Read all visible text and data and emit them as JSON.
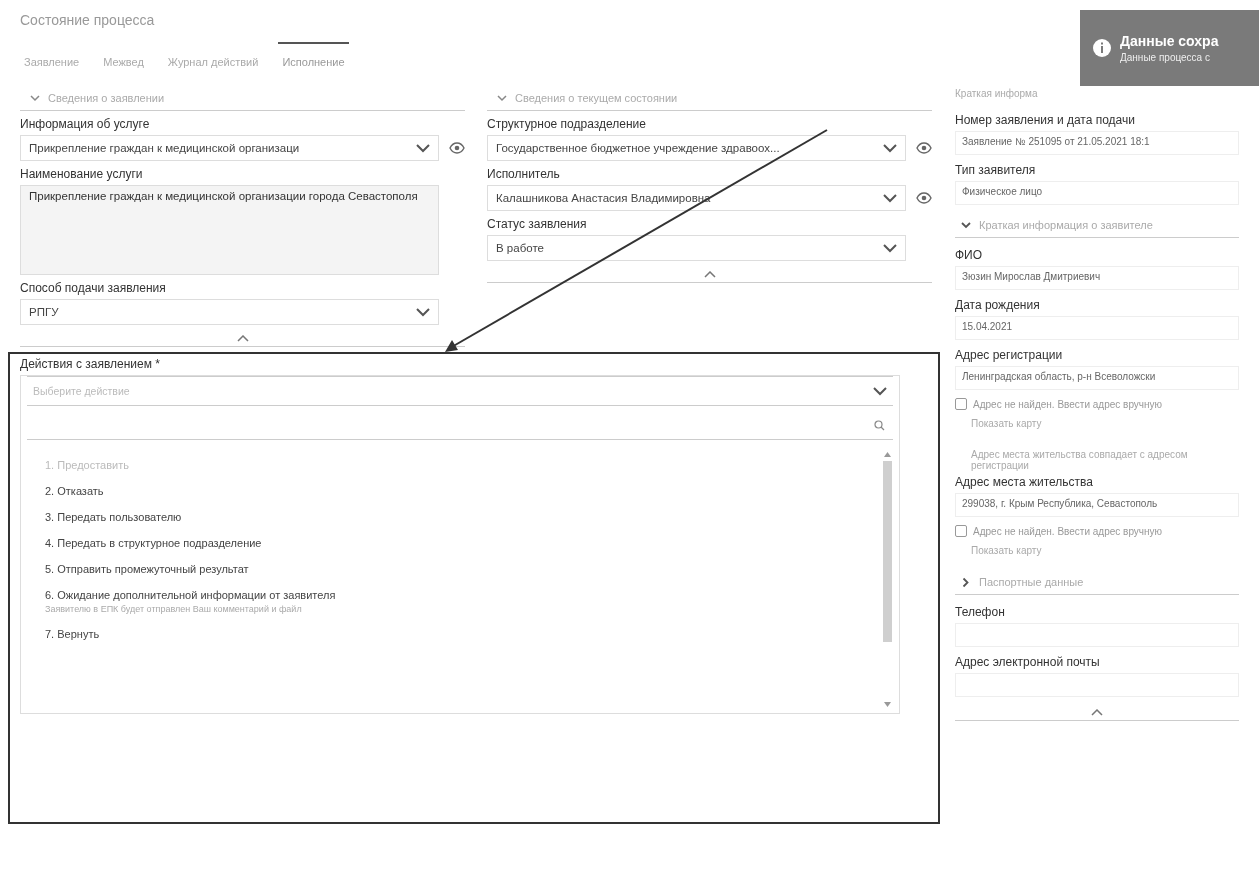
{
  "page_title": "Состояние процесса",
  "tabs": [
    {
      "label": "Заявление",
      "selected": false
    },
    {
      "label": "Межвед",
      "selected": false
    },
    {
      "label": "Журнал действий",
      "selected": false
    },
    {
      "label": "Исполнение",
      "selected": true
    }
  ],
  "application_section": {
    "title": "Сведения о заявлении",
    "expanded": true,
    "fields": [
      {
        "kind": "select",
        "label": "Информация об услуге",
        "value": "Прикрепление граждан к медицинской организаци",
        "eye": true
      },
      {
        "kind": "textarea",
        "label": "Наименование услуги",
        "value": "Прикрепление граждан к медицинской организации города Севастополя"
      },
      {
        "kind": "select",
        "label": "Способ подачи заявления",
        "value": "РПГУ",
        "eye": false
      }
    ]
  },
  "state_section": {
    "title": "Сведения о текущем состоянии",
    "expanded": true,
    "fields": [
      {
        "kind": "select",
        "label": "Структурное подразделение",
        "value": "Государственное бюджетное учреждение здравоох...",
        "eye": true
      },
      {
        "kind": "select",
        "label": "Исполнитель",
        "value": "Калашникова Анастасия Владимировна",
        "eye": true
      },
      {
        "kind": "select",
        "label": "Статус заявления",
        "value": "В работе",
        "eye": false
      }
    ]
  },
  "actions": {
    "label": "Действия с заявлением *",
    "placeholder": "Выберите действие",
    "items": [
      {
        "text": "1. Предоставить",
        "disabled": true
      },
      {
        "text": "2. Отказать",
        "disabled": false
      },
      {
        "text": "3. Передать пользователю",
        "disabled": false
      },
      {
        "text": "4. Передать в структурное подразделение",
        "disabled": false
      },
      {
        "text": "5. Отправить промежуточный результат",
        "disabled": false
      },
      {
        "text": "6. Ожидание дополнительной информации от заявителя",
        "disabled": false,
        "hint": "Заявителю в ЕПК будет отправлен Ваш комментарий и файл"
      },
      {
        "text": "7. Вернуть",
        "disabled": false
      }
    ]
  },
  "summary": {
    "items": [
      {
        "kind": "heading",
        "text": "Краткая информа"
      },
      {
        "kind": "field",
        "label": "Номер заявления и дата подачи",
        "value": "Заявление № 251095 от 21.05.2021 18:1"
      },
      {
        "kind": "field",
        "label": "Тип заявителя",
        "value": "Физическое лицо"
      },
      {
        "kind": "section",
        "text": "Краткая информация о заявителе",
        "expanded": true
      },
      {
        "kind": "field",
        "label": "ФИО",
        "value": "Зюзин Мирослав Дмитриевич"
      },
      {
        "kind": "field",
        "label": "Дата рождения",
        "value": "15.04.2021"
      },
      {
        "kind": "field",
        "label": "Адрес регистрации",
        "value": "Ленинградская область, р-н Всеволожски"
      },
      {
        "kind": "checkbox",
        "text": "Адрес не найден. Ввести адрес вручную",
        "checked": false
      },
      {
        "kind": "link",
        "text": "Показать карту"
      },
      {
        "kind": "note",
        "text": "Адрес места жительства совпадает с адресом регистрации"
      },
      {
        "kind": "field",
        "label": "Адрес места жительства",
        "value": "299038, г. Крым Республика, Севастополь"
      },
      {
        "kind": "checkbox",
        "text": "Адрес не найден. Ввести адрес вручную",
        "checked": false
      },
      {
        "kind": "link",
        "text": "Показать карту"
      },
      {
        "kind": "section",
        "text": "Паспортные данные",
        "expanded": false
      },
      {
        "kind": "field",
        "label": "Телефон"
      },
      {
        "kind": "field",
        "label": "Адрес электронной почты"
      }
    ]
  },
  "toast": {
    "title": "Данные сохра",
    "message": "Данные процесса с"
  }
}
